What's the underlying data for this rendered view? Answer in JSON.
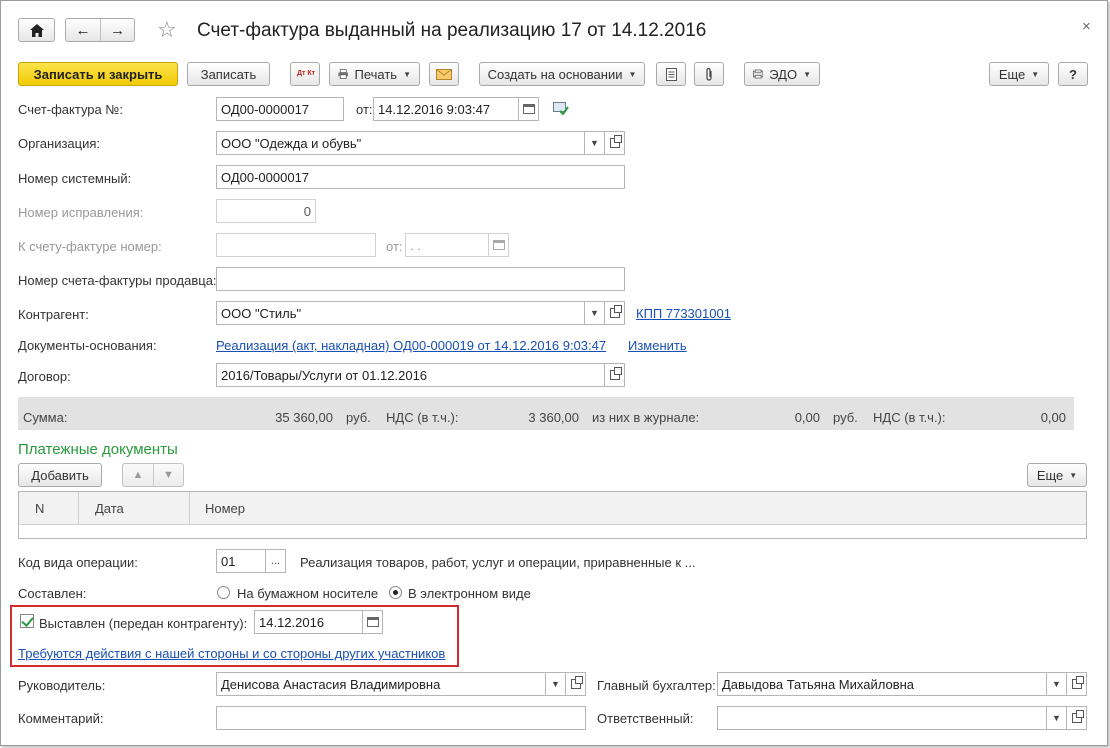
{
  "header": {
    "title": "Счет-фактура выданный на реализацию 17 от 14.12.2016",
    "home_icon": "home-icon",
    "back_symbol": "←",
    "forward_symbol": "→",
    "star_symbol": "☆",
    "close_symbol": "×"
  },
  "toolbar": {
    "save_close_label": "Записать и закрыть",
    "save_label": "Записать",
    "dtkt_label": "Дт Кт",
    "print_label": "Печать",
    "create_based_label": "Создать на основании",
    "edo_label": "ЭДО",
    "more_label": "Еще",
    "help_label": "?"
  },
  "form": {
    "invoice_no_label": "Счет-фактура №:",
    "invoice_no_value": "ОД00-0000017",
    "from_label": "от:",
    "date_value": "14.12.2016  9:03:47",
    "org_label": "Организация:",
    "org_value": "ООО \"Одежда и обувь\"",
    "system_no_label": "Номер системный:",
    "system_no_value": "ОД00-0000017",
    "correction_label": "Номер исправления:",
    "correction_value": "0",
    "to_invoice_label": "К счету-фактуре номер:",
    "to_invoice_value": "",
    "from2_label": "от:",
    "date2_value": " .  .",
    "seller_no_label": "Номер счета-фактуры продавца:",
    "seller_no_value": "",
    "counterparty_label": "Контрагент:",
    "counterparty_value": "ООО \"Стиль\"",
    "kpp_link": "КПП 773301001",
    "docs_label": "Документы-основания:",
    "docs_link": "Реализация (акт, накладная) ОД00-000019 от 14.12.2016 9:03:47",
    "change_link": "Изменить",
    "contract_label": "Договор:",
    "contract_value": "2016/Товары/Услуги от 01.12.2016"
  },
  "summary": {
    "sum_label": "Сумма:",
    "sum_value": "35 360,00",
    "currency1": "руб.",
    "vat_label1": "НДС (в т.ч.):",
    "vat_value1": "3 360,00",
    "journal_label": "из них в журнале:",
    "journal_value": "0,00",
    "currency2": "руб.",
    "vat_label2": "НДС (в т.ч.):",
    "vat_value2": "0,00"
  },
  "payments": {
    "section_title": "Платежные документы",
    "add_label": "Добавить",
    "more_label": "Еще",
    "columns": [
      "N",
      "Дата",
      "Номер"
    ]
  },
  "operation": {
    "code_label": "Код вида операции:",
    "code_value": "01",
    "code_btn": "...",
    "code_desc": "Реализация товаров, работ, услуг и операции, приравненные к ...",
    "composed_label": "Составлен:",
    "paper_label": "На бумажном носителе",
    "electronic_label": "В электронном виде"
  },
  "issued": {
    "label": "Выставлен (передан контрагенту):",
    "date_value": "14.12.2016",
    "action_link": "Требуются действия с нашей стороны и со стороны других участников"
  },
  "signers": {
    "head_label": "Руководитель:",
    "head_value": "Денисова Анастасия Владимировна",
    "accountant_label": "Главный бухгалтер:",
    "accountant_value": "Давыдова Татьяна Михайловна",
    "comment_label": "Комментарий:",
    "comment_value": "",
    "responsible_label": "Ответственный:",
    "responsible_value": ""
  },
  "colors": {
    "primary_button": "#f2cb06",
    "section_green": "#2a9a3c",
    "link_blue": "#1a4fb4",
    "highlight_red": "#d42a2a"
  }
}
